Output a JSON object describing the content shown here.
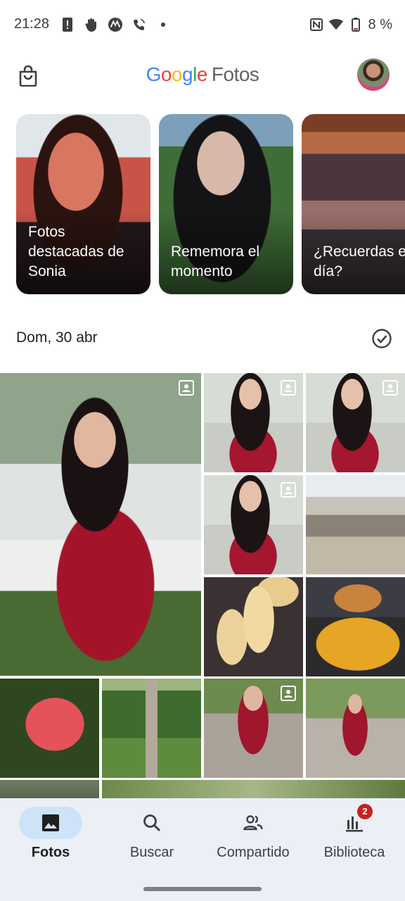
{
  "status_bar": {
    "time": "21:28",
    "battery_text": "8 %",
    "left_icons": [
      "alert-icon",
      "hand-icon",
      "motorola-icon",
      "wifi-call-icon",
      "dot-icon"
    ],
    "right_icons": [
      "nfc-icon",
      "wifi-icon",
      "battery-icon"
    ]
  },
  "app_bar": {
    "logo_google": "Google",
    "logo_product": "Fotos",
    "shop_icon": "shopping-bag-icon",
    "avatar_icon": "account-avatar"
  },
  "memories": [
    {
      "label": "Fotos destacadas de Sonia"
    },
    {
      "label": "Rememora el momento"
    },
    {
      "label": "¿Recuerdas este día?"
    }
  ],
  "section": {
    "date": "Dom, 30 abr",
    "select_icon": "check-circle-icon"
  },
  "grid": {
    "photos": [
      {
        "name": "photo-woman-bench",
        "badge": "person-icon"
      },
      {
        "name": "photo-woman-1",
        "badge": "person-icon"
      },
      {
        "name": "photo-woman-2",
        "badge": "person-icon"
      },
      {
        "name": "photo-woman-3",
        "badge": "person-icon"
      },
      {
        "name": "photo-market",
        "badge": ""
      },
      {
        "name": "photo-fries",
        "badge": ""
      },
      {
        "name": "photo-burger",
        "badge": ""
      },
      {
        "name": "photo-rose",
        "badge": ""
      },
      {
        "name": "photo-statue",
        "badge": ""
      },
      {
        "name": "photo-woman-4",
        "badge": "person-icon"
      },
      {
        "name": "photo-woman-5",
        "badge": ""
      }
    ]
  },
  "bottom_nav": {
    "items": [
      {
        "label": "Fotos",
        "icon": "photo-icon",
        "active": true
      },
      {
        "label": "Buscar",
        "icon": "search-icon",
        "active": false
      },
      {
        "label": "Compartido",
        "icon": "people-icon",
        "active": false
      },
      {
        "label": "Biblioteca",
        "icon": "library-icon",
        "active": false,
        "badge": "2"
      }
    ]
  },
  "colors": {
    "nav_background": "#eaf0f6",
    "nav_active_pill": "#cde3f7",
    "badge_red": "#c5221f",
    "google_blue": "#4285F4",
    "google_red": "#EA4335",
    "google_yellow": "#FBBC05",
    "google_green": "#34A853"
  }
}
